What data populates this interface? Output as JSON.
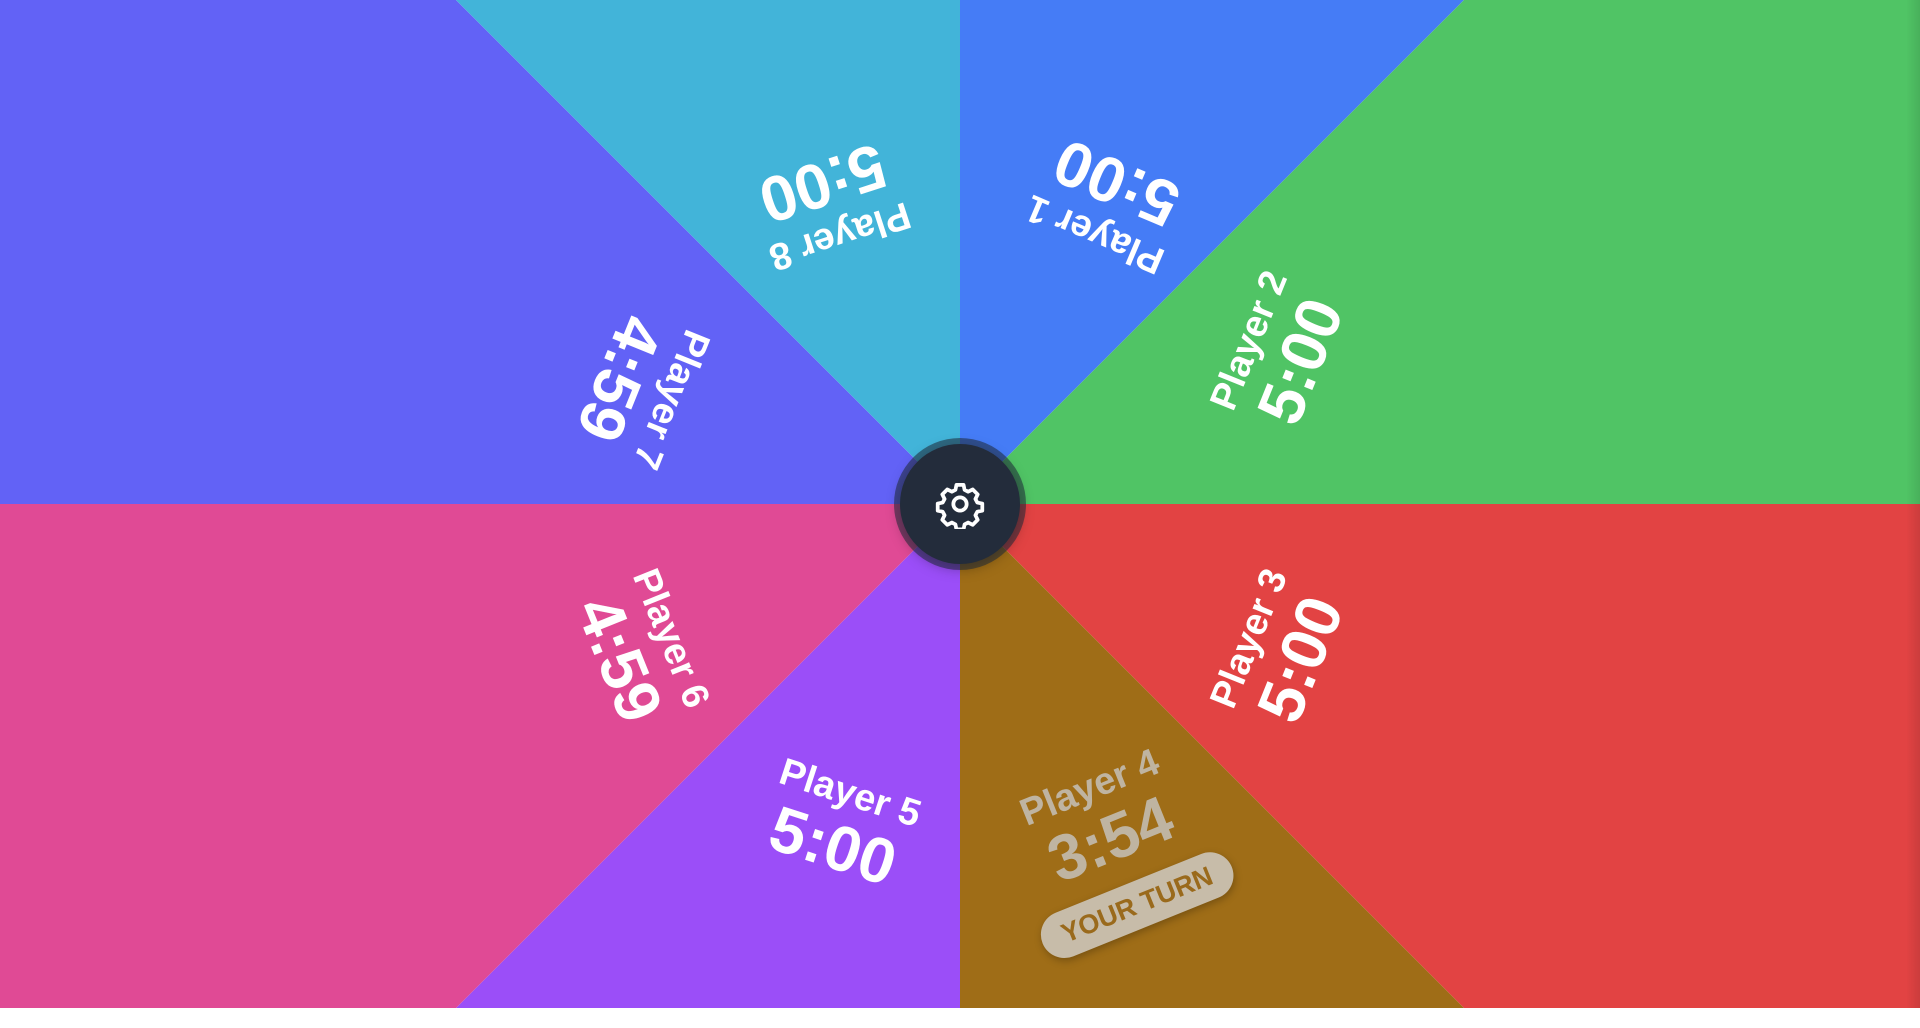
{
  "players": [
    {
      "name": "Player 1",
      "time": "5:00",
      "color": "#457cf6"
    },
    {
      "name": "Player 2",
      "time": "5:00",
      "color": "#50c465"
    },
    {
      "name": "Player 3",
      "time": "5:00",
      "color": "#e24343"
    },
    {
      "name": "Player 4",
      "time": "3:54",
      "color": "#9f6d17",
      "active": true,
      "badge": "YOUR TURN"
    },
    {
      "name": "Player 5",
      "time": "5:00",
      "color": "#9b4ef8"
    },
    {
      "name": "Player 6",
      "time": "4:59",
      "color": "#e04a95"
    },
    {
      "name": "Player 7",
      "time": "4:59",
      "color": "#6262f6"
    },
    {
      "name": "Player 8",
      "time": "5:00",
      "color": "#42b4d9"
    }
  ],
  "settings": {
    "icon": "gear-icon"
  }
}
